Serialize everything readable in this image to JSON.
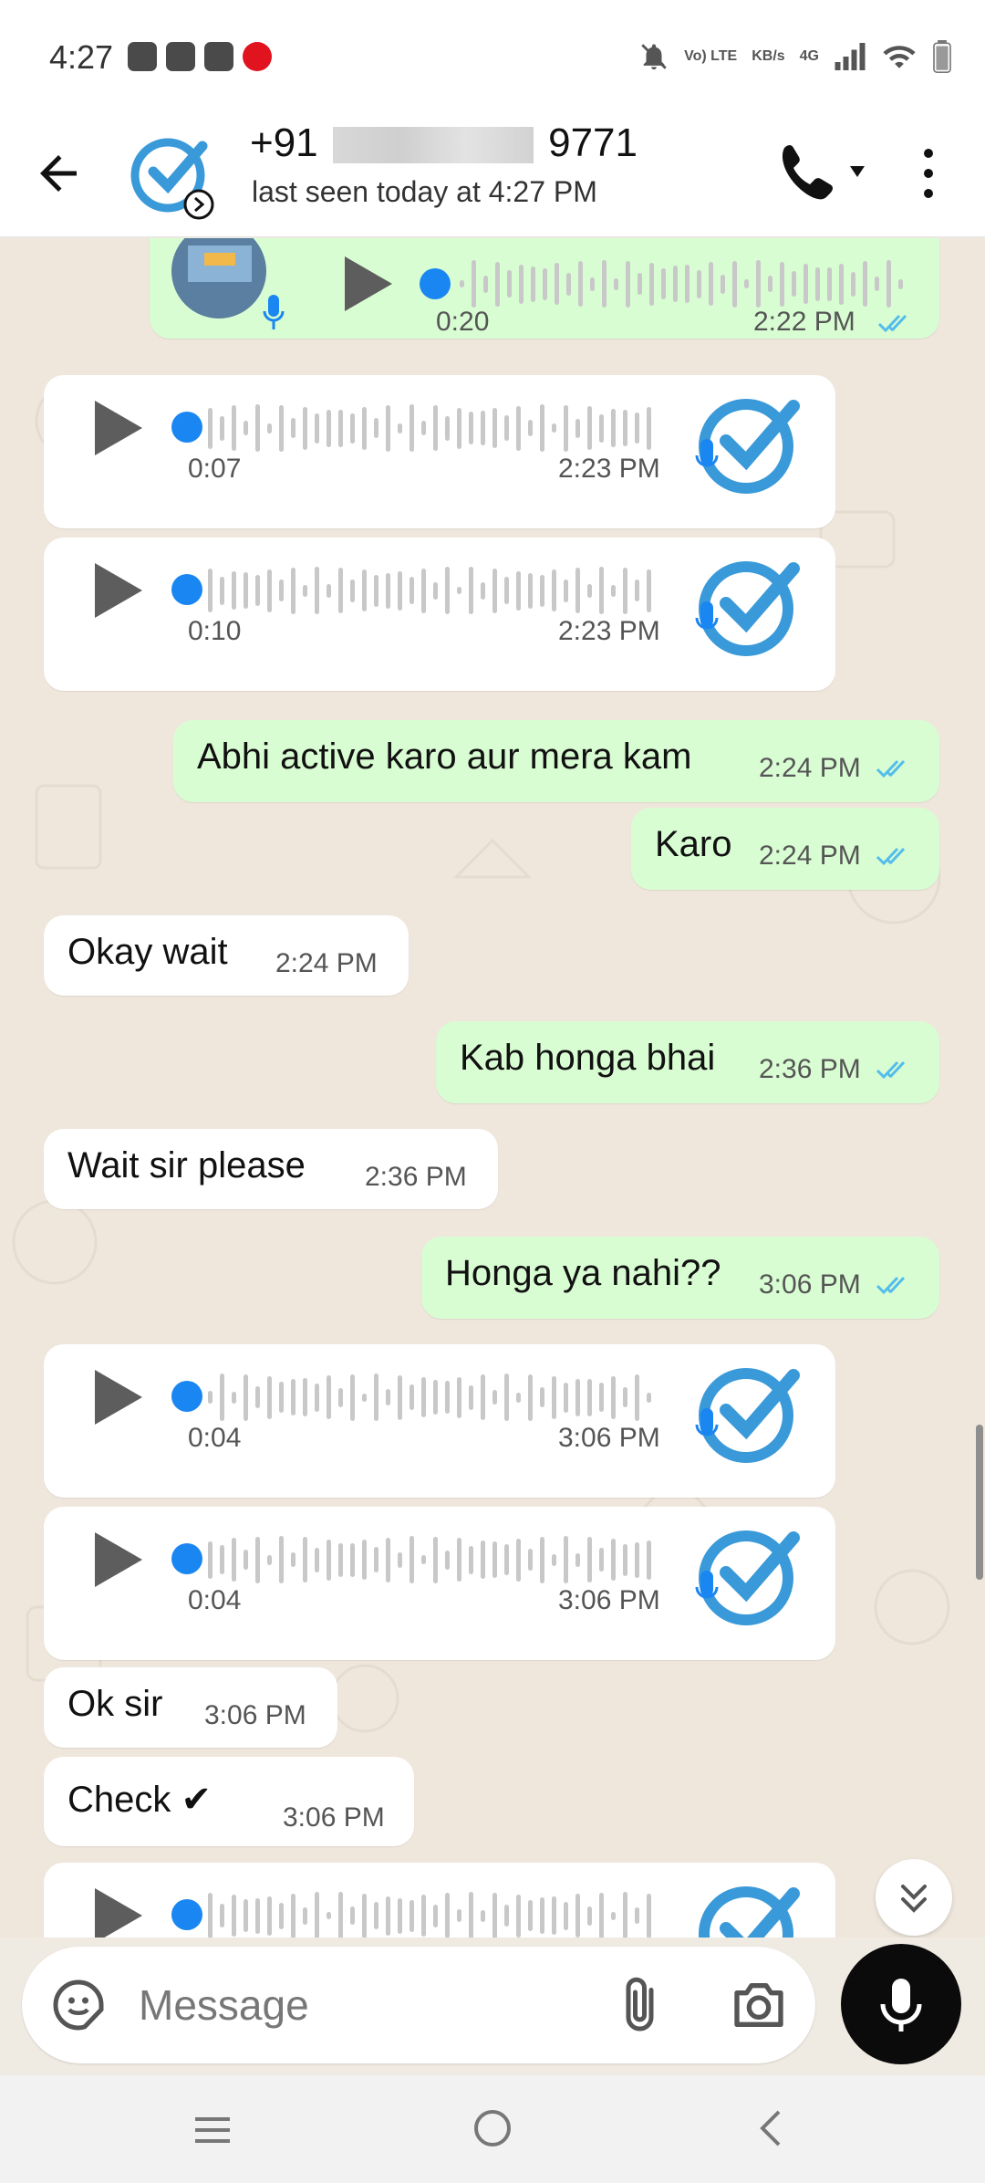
{
  "status_bar": {
    "time": "4:27",
    "volte_label": "Vo) LTE",
    "speed_label": "KB/s",
    "network_label": "4G"
  },
  "header": {
    "contact_prefix": "+91",
    "contact_suffix": "9771",
    "last_seen": "last seen today at 4:27 PM"
  },
  "messages": [
    {
      "type": "voice",
      "dir": "out",
      "duration": "0:20",
      "time": "2:22 PM",
      "status": "read"
    },
    {
      "type": "voice",
      "dir": "in",
      "duration": "0:07",
      "time": "2:23 PM"
    },
    {
      "type": "voice",
      "dir": "in",
      "duration": "0:10",
      "time": "2:23 PM"
    },
    {
      "type": "text",
      "dir": "out",
      "text": "Abhi active karo aur mera kam",
      "time": "2:24 PM",
      "status": "read"
    },
    {
      "type": "text",
      "dir": "out",
      "text": "Karo",
      "time": "2:24 PM",
      "status": "read"
    },
    {
      "type": "text",
      "dir": "in",
      "text": "Okay wait",
      "time": "2:24 PM"
    },
    {
      "type": "text",
      "dir": "out",
      "text": "Kab honga bhai",
      "time": "2:36 PM",
      "status": "read"
    },
    {
      "type": "text",
      "dir": "in",
      "text": "Wait sir please",
      "time": "2:36 PM"
    },
    {
      "type": "text",
      "dir": "out",
      "text": "Honga ya nahi??",
      "time": "3:06 PM",
      "status": "read"
    },
    {
      "type": "voice",
      "dir": "in",
      "duration": "0:04",
      "time": "3:06 PM"
    },
    {
      "type": "voice",
      "dir": "in",
      "duration": "0:04",
      "time": "3:06 PM"
    },
    {
      "type": "text",
      "dir": "in",
      "text": "Ok sir",
      "time": "3:06 PM"
    },
    {
      "type": "text",
      "dir": "in",
      "text": "Check ✔",
      "time": "3:06 PM"
    },
    {
      "type": "voice",
      "dir": "in",
      "duration": "",
      "time": ""
    }
  ],
  "input": {
    "placeholder": "Message"
  },
  "icons": {
    "back": "back-arrow-icon",
    "call": "phone-icon",
    "menu": "more-vert-icon",
    "sticker": "sticker-icon",
    "attach": "paperclip-icon",
    "camera": "camera-icon",
    "mic": "mic-icon",
    "scroll_down": "double-chevron-down-icon"
  },
  "colors": {
    "outgoing_bubble": "#d9fdd3",
    "incoming_bubble": "#ffffff",
    "read_tick": "#53bdeb",
    "voice_dot": "#1a86f2"
  }
}
